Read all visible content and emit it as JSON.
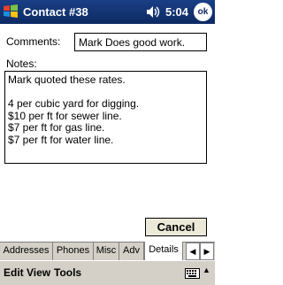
{
  "titlebar": {
    "title": "Contact #38",
    "time": "5:04",
    "ok_label": "ok"
  },
  "form": {
    "comments_label": "Comments:",
    "comments_value": "Mark Does good work.",
    "notes_label": "Notes:",
    "notes_lines": [
      "Mark quoted these rates.",
      "",
      "4 per cubic yard for digging.",
      "$10 per ft for sewer line.",
      "$7 per ft for gas line.",
      "$7 per ft for water line."
    ]
  },
  "buttons": {
    "cancel": "Cancel"
  },
  "tabs": [
    {
      "label": "Addresses",
      "active": false
    },
    {
      "label": "Phones",
      "active": false
    },
    {
      "label": "Misc",
      "active": false
    },
    {
      "label": "Adv",
      "active": false
    },
    {
      "label": "Details",
      "active": true
    }
  ],
  "menu": {
    "edit": "Edit",
    "view": "View",
    "tools": "Tools"
  },
  "icons": {
    "start": "windows-flag-icon",
    "volume": "speaker-icon",
    "keyboard": "keyboard-icon"
  },
  "colors": {
    "titlebar": "#0d2a63",
    "chrome": "#d4d0c8"
  }
}
